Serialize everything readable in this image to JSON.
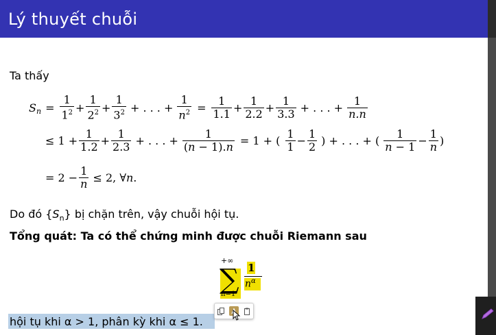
{
  "slide": {
    "title": "Lý thuyết chuỗi",
    "intro": "Ta thấy",
    "math": {
      "line1": {
        "lhs": "S",
        "lhs_sub": "n",
        "terms_a": [
          "1/1²",
          "1/2²",
          "1/3²"
        ],
        "dots": "+ . . . +",
        "term_na": "1/n²",
        "terms_b": [
          "1/1.1",
          "1/2.2",
          "1/3.3"
        ],
        "term_nb": "1/n.n"
      },
      "line2": "≤ 1 + 1/1.2 + 1/2.3 + . . . + 1/((n − 1).n) = 1 + (1/1 − 1/2) + . . . + (1/(n − 1) − 1/n)",
      "line3": "= 2 − 1/n ≤ 2, ∀n."
    },
    "conclude_bounded": "Do đó {Sn} bị chặn trên, vậy chuỗi hội tụ.",
    "general_heading": "Tổng quát: Ta có thể chứng minh được chuỗi Riemann sau",
    "riemann": {
      "upper": "+∞",
      "lower": "n=1",
      "numerator": "1",
      "denominator": "nα"
    },
    "conclusion": "hội tụ khi α > 1, phân kỳ khi α ≤ 1."
  },
  "colors": {
    "title_bar": "#3333b2",
    "highlight_yellow": "#f0e000",
    "selection_blue": "#b7cfe6"
  },
  "popup_tools": [
    "copy-icon",
    "highlight-icon",
    "paste-icon"
  ]
}
